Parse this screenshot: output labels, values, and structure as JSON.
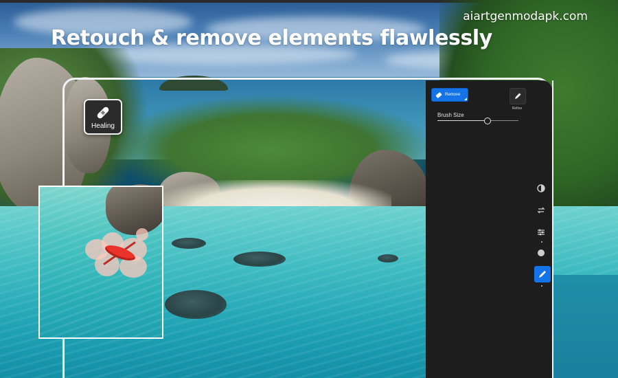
{
  "headline": "Retouch & remove elements flawlessly",
  "watermark": "aiartgenmodapk.com",
  "healing_badge": {
    "label": "Healing",
    "icon": "bandage-icon"
  },
  "edit_panel": {
    "remove_button": {
      "label": "Remove",
      "icon": "eraser-icon",
      "active": true
    },
    "refine_button": {
      "label": "Refine",
      "icon": "pencil-icon"
    },
    "brush_size": {
      "label": "Brush Size",
      "value_fraction": 0.62
    },
    "tools": [
      {
        "name": "blur-tool",
        "icon": "blur-icon"
      },
      {
        "name": "swap-tool",
        "icon": "swap-icon"
      },
      {
        "name": "adjust-tool",
        "icon": "sliders-icon"
      },
      {
        "name": "color-tool",
        "icon": "circle-icon"
      },
      {
        "name": "retouch-tool",
        "icon": "pencil-icon",
        "active": true
      }
    ]
  },
  "colors": {
    "accent": "#1473e6",
    "panel": "#1d1d1d",
    "frame": "#f1f3f4"
  }
}
